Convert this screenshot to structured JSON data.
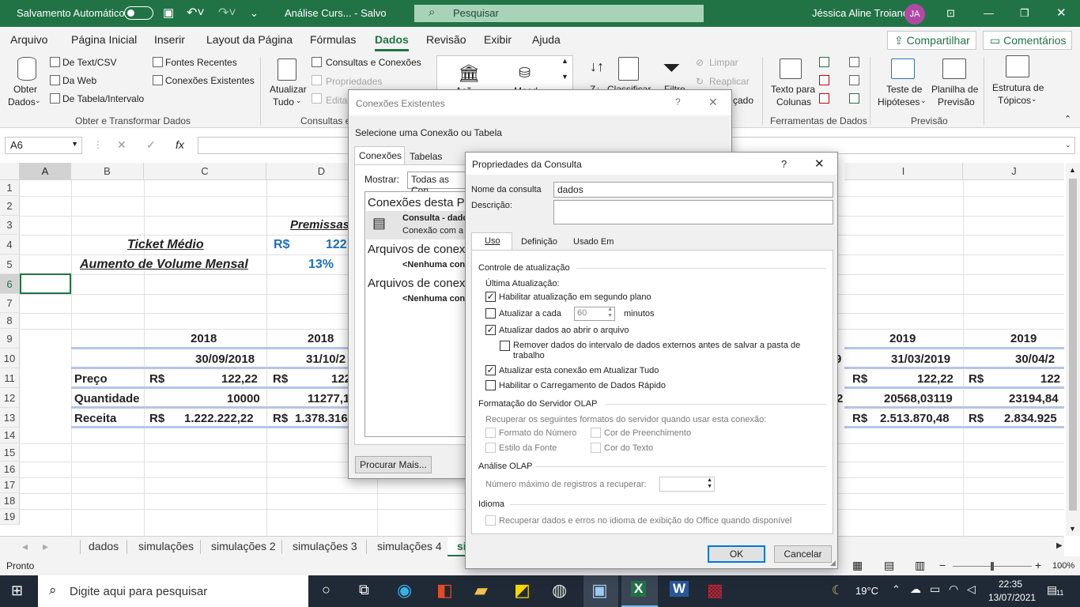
{
  "titlebar": {
    "autosave": "Salvamento Automático",
    "doc": "Análise Curs... - Salvo",
    "search": "Pesquisar",
    "user": "Jéssica Aline Troiano",
    "initials": "JA"
  },
  "menu": {
    "items": [
      "Arquivo",
      "Página Inicial",
      "Inserir",
      "Layout da Página",
      "Fórmulas",
      "Dados",
      "Revisão",
      "Exibir",
      "Ajuda"
    ],
    "share": "Compartilhar",
    "comments": "Comentários"
  },
  "ribbon": {
    "obter_dados": "Obter",
    "obter_dados2": "Dados",
    "text_csv": "De Text/CSV",
    "web": "Da Web",
    "tabela": "De Tabela/Intervalo",
    "recentes": "Fontes Recentes",
    "existentes": "Conexões Existentes",
    "group1": "Obter e Transformar Dados",
    "atualizar": "Atualizar",
    "atualizar2": "Tudo",
    "consultas": "Consultas e Conexões",
    "propriedades": "Propriedades",
    "editar": "Editar",
    "group2": "Consultas e",
    "acoes": "Açõ",
    "moed": "Moed",
    "classificar": "Classificar",
    "filtro": "Filtro",
    "limpar": "Limpar",
    "reaplicar": "Reaplicar",
    "avancado": "çado",
    "texto_colunas": "Texto para",
    "texto_colunas2": "Colunas",
    "group4": "Ferramentas de Dados",
    "teste": "Teste de",
    "teste2": "Hipóteses",
    "planilha": "Planilha de",
    "planilha2": "Previsão",
    "group5": "Previsão",
    "estrutura": "Estrutura de",
    "estrutura2": "Tópicos"
  },
  "formula": {
    "namebox": "A6",
    "fx": "fx"
  },
  "columns": [
    "A",
    "B",
    "C",
    "D",
    "I",
    "J"
  ],
  "rows": [
    "1",
    "2",
    "3",
    "4",
    "5",
    "6",
    "7",
    "8",
    "9",
    "10",
    "11",
    "12",
    "13",
    "14",
    "15",
    "16",
    "17",
    "18",
    "19"
  ],
  "sheet": {
    "premissas": "Premissas",
    "ticket_label": "Ticket Médio",
    "ticket_cur": "R$",
    "ticket_val": "122",
    "aumento_label": "Aumento de Volume Mensal",
    "aumento_val": "13%",
    "year_c": "2018",
    "year_d": "2018",
    "year_i": "2019",
    "year_j": "2019",
    "date_c": "30/09/2018",
    "date_d": "31/10/2",
    "date_h": "9",
    "date_i": "31/03/2019",
    "date_j": "30/04/2",
    "preco": "Preço",
    "quantidade": "Quantidade",
    "receita": "Receita",
    "cur": "R$",
    "preco_c": "122,22",
    "preco_d": "122",
    "preco_i": "122,22",
    "preco_j": "122",
    "qtd_c": "10000",
    "qtd_d": "11277,1",
    "qtd_h": "2",
    "qtd_i": "20568,03119",
    "qtd_j": "23194,84",
    "rec_c": "1.222.222,22",
    "rec_d": "1.378.316",
    "rec_i": "2.513.870,48",
    "rec_j": "2.834.925"
  },
  "tabs": [
    "dados",
    "simulações",
    "simulações 2",
    "simulações 3",
    "simulações 4",
    "si"
  ],
  "status": {
    "ready": "Pronto",
    "zoom": "100%"
  },
  "taskbar": {
    "search": "Digite aqui para pesquisar",
    "temp": "19°C",
    "time": "22:35",
    "date": "13/07/2021",
    "notif": "11"
  },
  "conexoes": {
    "title": "Conexões Existentes",
    "help": "?",
    "select_label": "Selecione uma Conexão ou Tabela",
    "tab_conexoes": "Conexões",
    "tab_tabelas": "Tabelas",
    "mostrar": "Mostrar:",
    "mostrar_val": "Todas as Con",
    "sec1": "Conexões desta Pa",
    "item_title": "Consulta - dado",
    "item_sub": "Conexão com a",
    "sec2": "Arquivos de conex",
    "none1": "<Nenhuma con",
    "sec3": "Arquivos de conex",
    "none2": "<Nenhuma con",
    "procurar": "Procurar Mais..."
  },
  "propriedades": {
    "title": "Propriedades da Consulta",
    "help": "?",
    "nome_label": "Nome da consulta",
    "nome_val": "dados",
    "descricao_label": "Descrição:",
    "tab_uso": "Uso",
    "tab_definicao": "Definição",
    "tab_usado": "Usado Em",
    "controle": "Controle de atualização",
    "ultima": "Última Atualização:",
    "cb1": "Habilitar atualização em segundo plano",
    "cb2": "Atualizar a cada",
    "cb2_val": "60",
    "cb2_unit": "minutos",
    "cb3": "Atualizar dados ao abrir o arquivo",
    "cb4a": "Remover dados do intervalo de dados externos antes de salvar a pasta de",
    "cb4b": "trabalho",
    "cb5": "Atualizar esta conexão em Atualizar Tudo",
    "cb6": "Habilitar o Carregamento de Dados Rápido",
    "olap_sec": "Formatação do Servidor OLAP",
    "olap_desc": "Recuperar os seguintes formatos do servidor quando usar esta conexão:",
    "fmt_num": "Formato do Número",
    "cor_pre": "Cor de Preenchimento",
    "estilo": "Estilo da Fonte",
    "cor_texto": "Cor do Texto",
    "analise": "Análise OLAP",
    "max_reg": "Número máximo de registros a recuperar:",
    "idioma": "Idioma",
    "idioma_cb": "Recuperar dados e erros no idioma de exibição do Office quando disponível",
    "ok": "OK",
    "cancelar": "Cancelar"
  }
}
